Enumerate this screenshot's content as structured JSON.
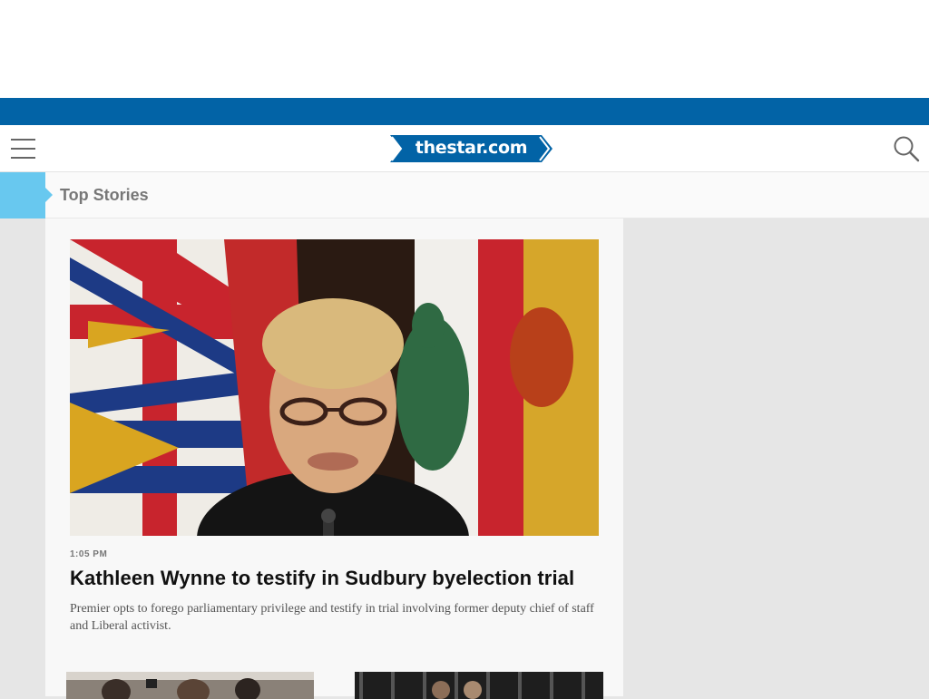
{
  "site": {
    "logo_text": "thestar.com",
    "brand_blue": "#0263a6",
    "accent_cyan": "#68c8ef"
  },
  "header": {
    "menu_icon": "hamburger-menu-icon",
    "search_icon": "search-icon"
  },
  "section": {
    "title": "Top Stories"
  },
  "lead_story": {
    "timestamp": "1:05 PM",
    "headline": "Kathleen Wynne to testify in Sudbury byelection trial",
    "summary": "Premier opts to forego parliamentary privilege and testify in trial involving former deputy chief of staff and Liberal activist."
  }
}
